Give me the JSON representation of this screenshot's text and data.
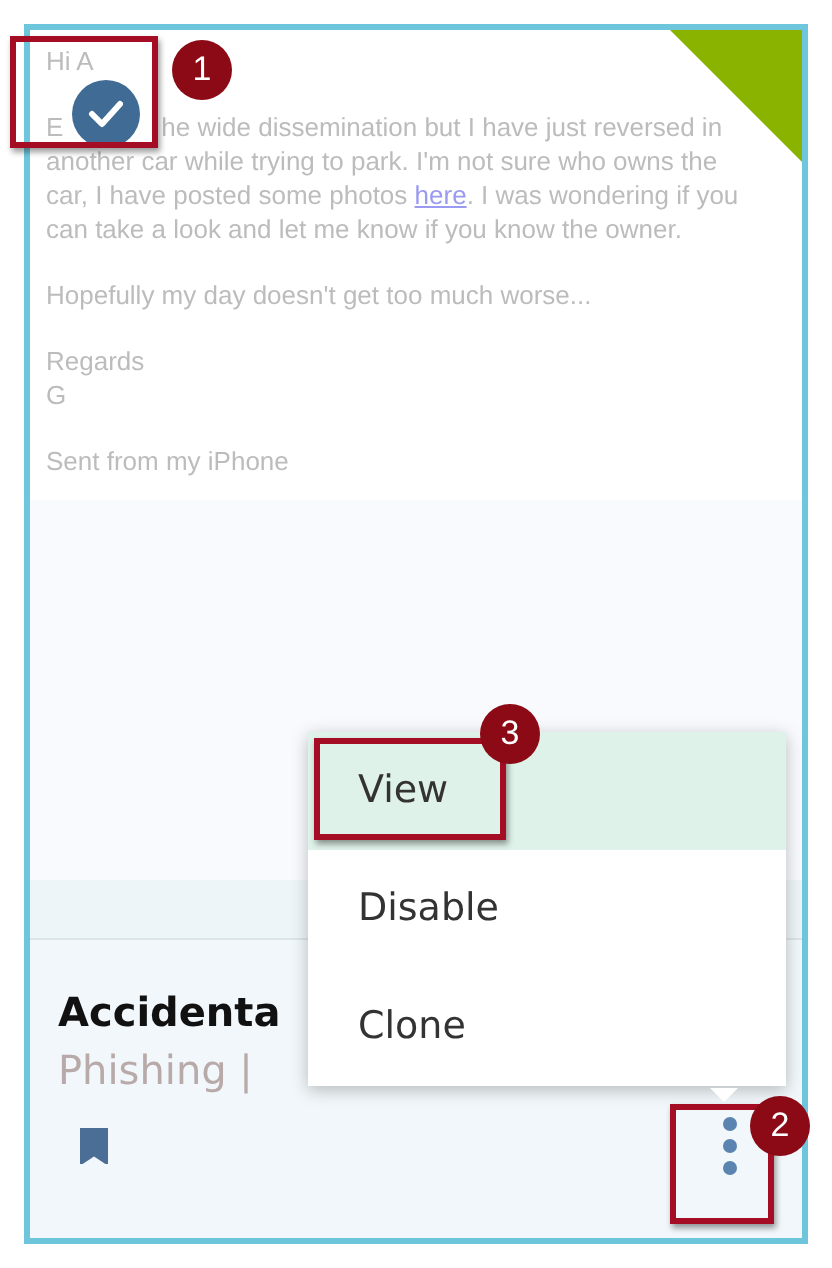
{
  "email_preview": {
    "paragraphs": [
      {
        "lines": [
          {
            "kind": "plain",
            "text": "Hi A"
          }
        ]
      },
      {
        "lines": [
          {
            "kind": "split",
            "left": "E",
            "right": "he wide dissemination but I have just reversed in"
          },
          {
            "kind": "plain",
            "text": "another car while trying to park. I'm not sure who owns the"
          },
          {
            "kind": "link",
            "before": "car, I have posted some photos ",
            "link": "here",
            "after": ". I was wondering if you"
          },
          {
            "kind": "plain",
            "text": "can take a look and let me know if you know the owner."
          }
        ]
      },
      {
        "lines": [
          {
            "kind": "plain",
            "text": "Hopefully my day doesn't get too much worse..."
          }
        ]
      },
      {
        "lines": [
          {
            "kind": "plain",
            "text": "Regards"
          },
          {
            "kind": "plain",
            "text": "G"
          }
        ]
      },
      {
        "lines": [
          {
            "kind": "plain",
            "text": "Sent from my iPhone"
          }
        ]
      }
    ]
  },
  "select_badge": {
    "checked": true
  },
  "title": "Accidenta",
  "subtitle": "Phishing |",
  "bookmarked": true,
  "menu": {
    "items": [
      {
        "label": "View",
        "selected": true
      },
      {
        "label": "Disable",
        "selected": false
      },
      {
        "label": "Clone",
        "selected": false
      }
    ]
  },
  "annotations": [
    {
      "number": "1"
    },
    {
      "number": "2"
    },
    {
      "number": "3"
    }
  ]
}
